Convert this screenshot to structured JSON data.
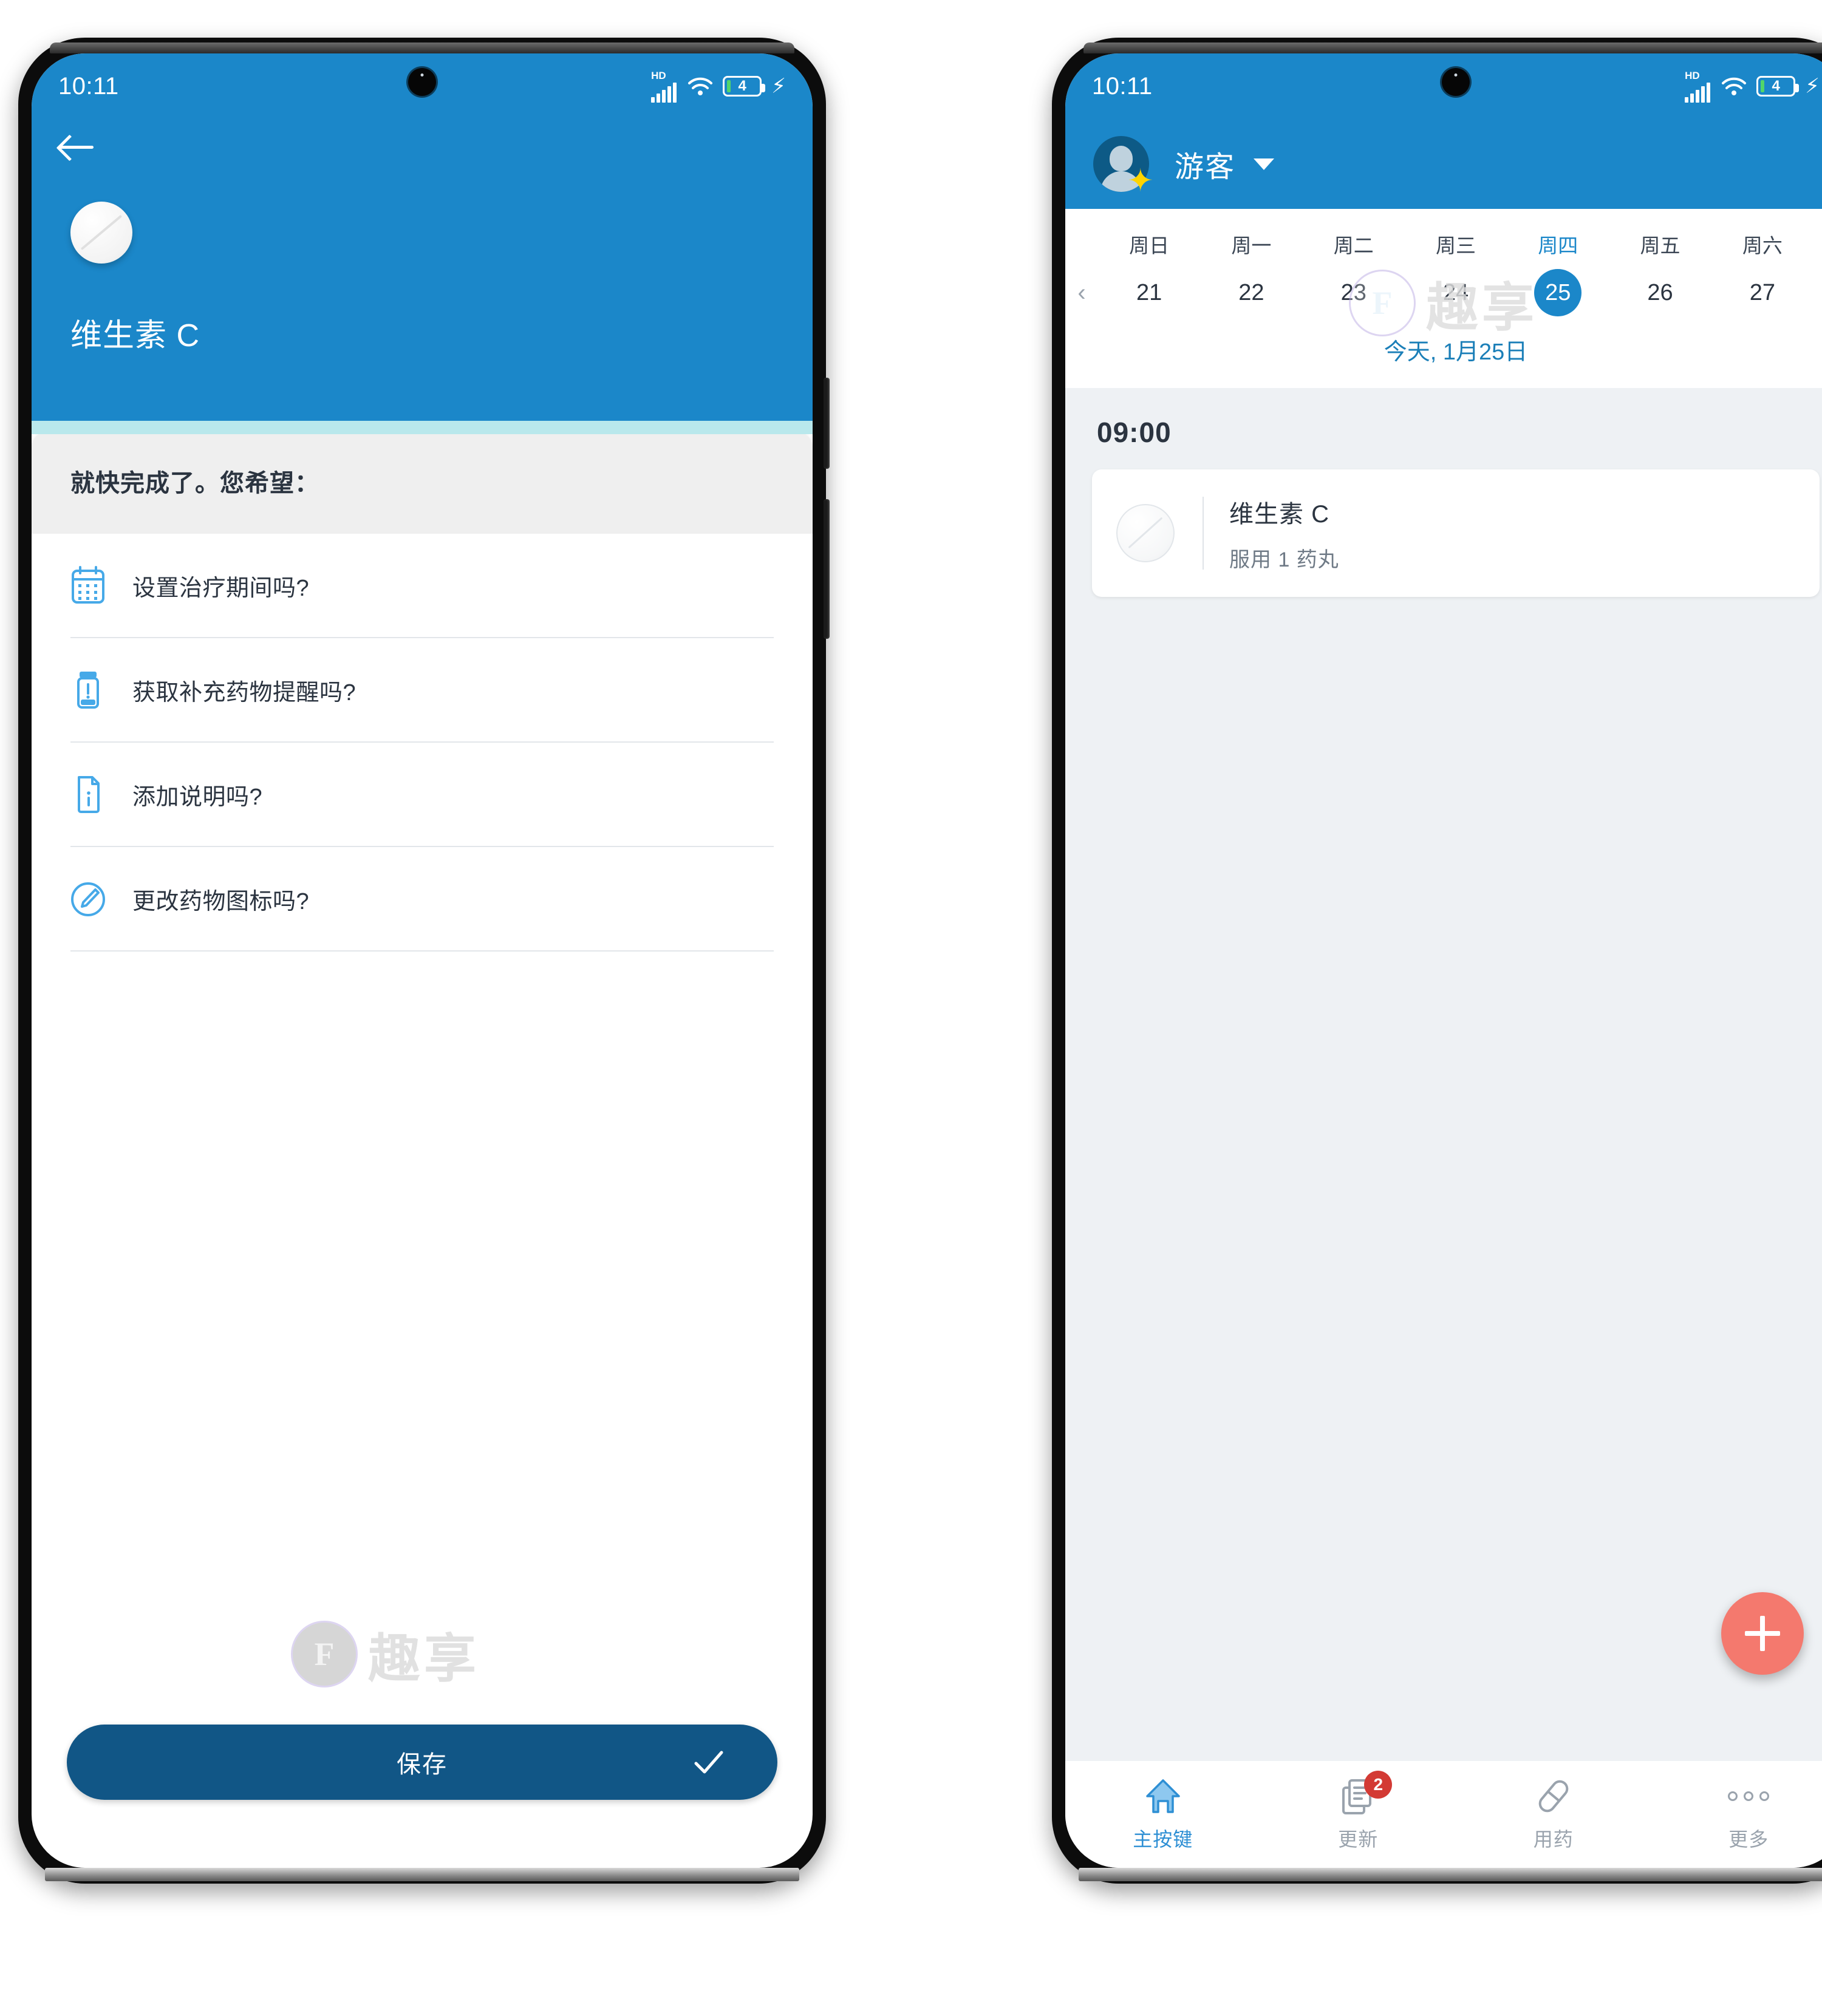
{
  "status_bar": {
    "time": "10:11",
    "network_label": "HD",
    "battery_level": "4",
    "icons": [
      "hd-signal-icon",
      "wifi-icon",
      "battery-icon",
      "charging-bolt-icon"
    ]
  },
  "colors": {
    "primary_blue": "#1b87c9",
    "dark_blue": "#115686",
    "accent_coral": "#f4796e",
    "progress_track": "#b9e8ec",
    "banner_gray": "#efefef",
    "agenda_bg": "#eef1f4",
    "badge_red": "#d33a34",
    "today_link": "#1b7fb8"
  },
  "watermark": {
    "badge_letter": "F",
    "text": "趣享"
  },
  "left_screen": {
    "back_button": "back-arrow",
    "medicine_icon": "round-pill-icon",
    "medicine_name": "维生素 C",
    "banner_text": "就快完成了。您希望：",
    "options": [
      {
        "icon": "calendar-icon",
        "label": "设置治疗期间吗?"
      },
      {
        "icon": "pill-bottle-icon",
        "label": "获取补充药物提醒吗?"
      },
      {
        "icon": "document-info-icon",
        "label": "添加说明吗?"
      },
      {
        "icon": "edit-pencil-icon",
        "label": "更改药物图标吗?"
      }
    ],
    "save_button": {
      "label": "保存",
      "check_icon": "check-icon"
    }
  },
  "right_screen": {
    "header": {
      "avatar": "user-avatar",
      "username": "游客",
      "dropdown_icon": "chevron-down-icon"
    },
    "week": {
      "prev_icon": "chevron-left-icon",
      "next_icon": "chevron-right-icon",
      "days": [
        {
          "name": "周日",
          "num": "21",
          "selected": false
        },
        {
          "name": "周一",
          "num": "22",
          "selected": false
        },
        {
          "name": "周二",
          "num": "23",
          "selected": false
        },
        {
          "name": "周三",
          "num": "24",
          "selected": false
        },
        {
          "name": "周四",
          "num": "25",
          "selected": true
        },
        {
          "name": "周五",
          "num": "26",
          "selected": false
        },
        {
          "name": "周六",
          "num": "27",
          "selected": false
        }
      ],
      "today_label": "今天, 1月25日"
    },
    "agenda": {
      "time": "09:00",
      "items": [
        {
          "icon": "round-pill-icon",
          "name": "维生素 C",
          "dose": "服用 1 药丸"
        }
      ]
    },
    "fab": {
      "icon": "plus-icon"
    },
    "tabs": [
      {
        "icon": "home-icon",
        "label": "主按键",
        "active": true,
        "badge": ""
      },
      {
        "icon": "refresh-doc-icon",
        "label": "更新",
        "active": false,
        "badge": "2"
      },
      {
        "icon": "capsule-icon",
        "label": "用药",
        "active": false,
        "badge": ""
      },
      {
        "icon": "more-dots-icon",
        "label": "更多",
        "active": false,
        "badge": ""
      }
    ]
  }
}
